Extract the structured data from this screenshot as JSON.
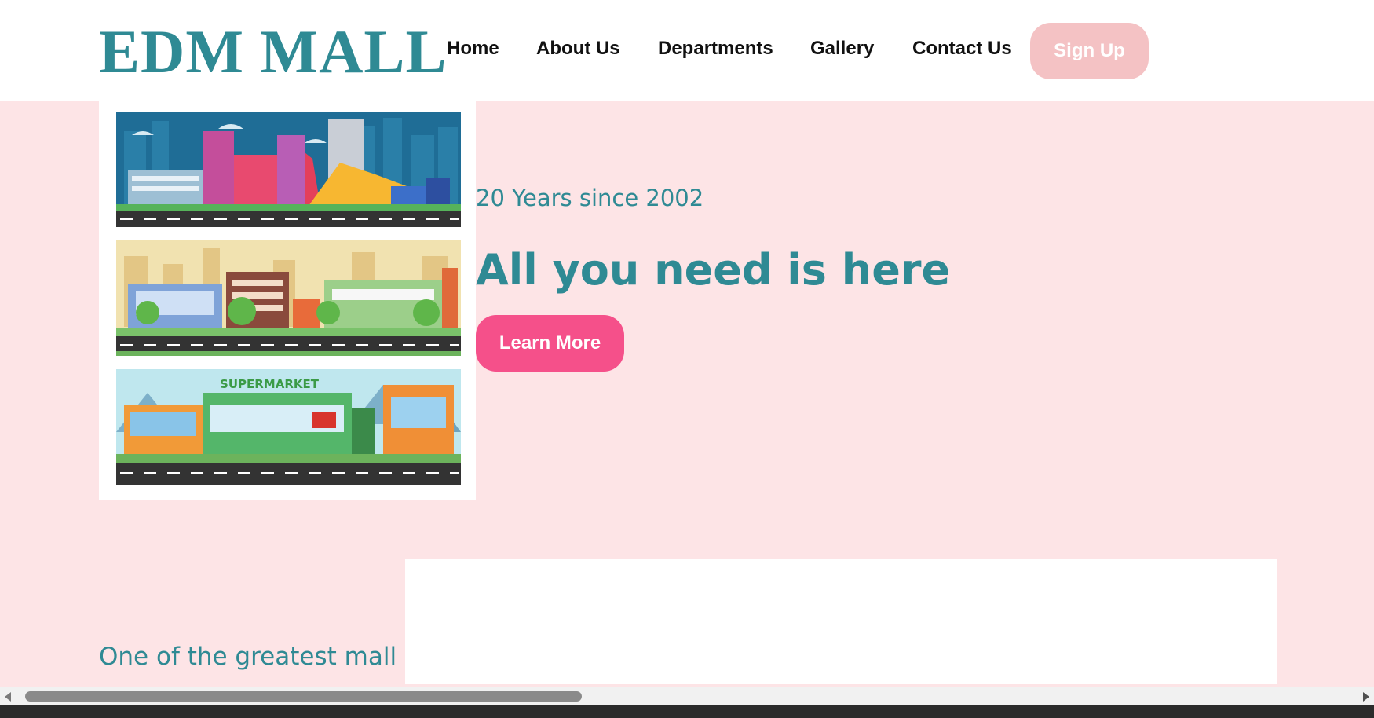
{
  "header": {
    "logo": "EDM MALL",
    "nav": [
      "Home",
      "About Us",
      "Departments",
      "Gallery",
      "Contact Us"
    ],
    "signup_label": "Sign Up"
  },
  "hero": {
    "subtitle": "20 Years since 2002",
    "title": "All you need is here",
    "cta_label": "Learn More"
  },
  "gallery": {
    "scenes": [
      {
        "name": "city-mall-illustration"
      },
      {
        "name": "shopping-street-illustration"
      },
      {
        "name": "supermarket-illustration",
        "sign": "SUPERMARKET"
      }
    ]
  },
  "about": {
    "tagline": "One of the greatest mall"
  },
  "colors": {
    "brand": "#2f8a94",
    "background": "#fde4e6",
    "cta": "#f5508a",
    "signup": "#f4c2c4"
  }
}
